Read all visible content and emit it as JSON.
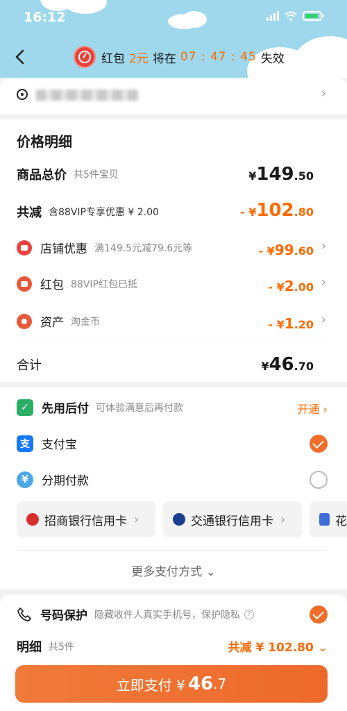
{
  "status": {
    "time": "16:12"
  },
  "banner": {
    "text_before": "红包",
    "amount": "2元",
    "text_mid": "将在",
    "countdown": "07 : 47 : 45",
    "text_after": "失效"
  },
  "price_detail": {
    "title": "价格明细",
    "total": {
      "label": "商品总价",
      "sub": "共5件宝贝",
      "yen": "¥",
      "int": "149",
      "dec": ".50"
    },
    "reduce": {
      "label": "共减",
      "sub": "含88VIP专享优惠 ¥ 2.00",
      "prefix": "- ¥",
      "int": "102",
      "dec": ".80"
    },
    "items": [
      {
        "label": "店铺优惠",
        "sub": "满149.5元减79.6元等",
        "prefix": "- ¥",
        "int": "99",
        "dec": ".60",
        "color": "#e84444"
      },
      {
        "label": "红包",
        "sub": "88VIP红包已抵",
        "prefix": "- ¥",
        "int": "2",
        "dec": ".00",
        "color": "#e8563a"
      },
      {
        "label": "资产",
        "sub": "淘金币",
        "prefix": "- ¥",
        "int": "1",
        "dec": ".20",
        "color": "#e85a3a"
      }
    ],
    "sum": {
      "label": "合计",
      "yen": "¥",
      "int": "46",
      "dec": ".70"
    }
  },
  "payment": {
    "bnpl": {
      "label": "先用后付",
      "sub": "可体验满意后再付款",
      "action": "开通"
    },
    "alipay": {
      "label": "支付宝",
      "selected": true
    },
    "installment": {
      "label": "分期付款",
      "selected": false
    },
    "banks": [
      "招商银行信用卡",
      "交通银行信用卡",
      "花"
    ],
    "more": "更多支付方式"
  },
  "bottom": {
    "protect_label": "号码保护",
    "protect_sub": "隐藏收件人真实手机号，保护隐私",
    "detail_label": "明细",
    "detail_sub": "共5件",
    "detail_reduce": "共减 ¥ 102.80",
    "pay_label": "立即支付 ¥",
    "pay_int": "46",
    "pay_dec": ".7"
  },
  "colors": {
    "accent": "#f06d2a",
    "header": "#9fd8ec"
  }
}
